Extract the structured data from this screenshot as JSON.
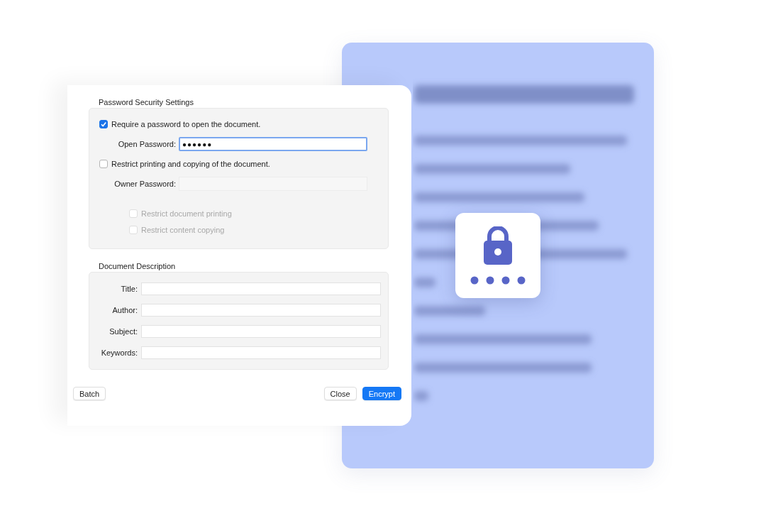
{
  "security": {
    "heading": "Password Security Settings",
    "require_open": {
      "label": "Require a password to open the document.",
      "checked": true
    },
    "open_password": {
      "label": "Open Password:",
      "value": "●●●●●●",
      "focused": true,
      "disabled": false
    },
    "restrict": {
      "label": "Restrict printing and copying of the document.",
      "checked": false
    },
    "owner_password": {
      "label": "Owner Password:",
      "disabled": true
    },
    "options": [
      {
        "label": "Restrict document printing",
        "checked": false,
        "disabled": true
      },
      {
        "label": "Restrict content copying",
        "checked": false,
        "disabled": true
      }
    ]
  },
  "description": {
    "heading": "Document Description",
    "fields": [
      {
        "label": "Title:"
      },
      {
        "label": "Author:"
      },
      {
        "label": "Subject:"
      },
      {
        "label": "Keywords:"
      }
    ]
  },
  "left_buttons": [
    {
      "label": "Batch",
      "kind": "default"
    }
  ],
  "right_buttons": [
    {
      "label": "Close",
      "kind": "default"
    },
    {
      "label": "Encrypt",
      "kind": "primary"
    }
  ]
}
